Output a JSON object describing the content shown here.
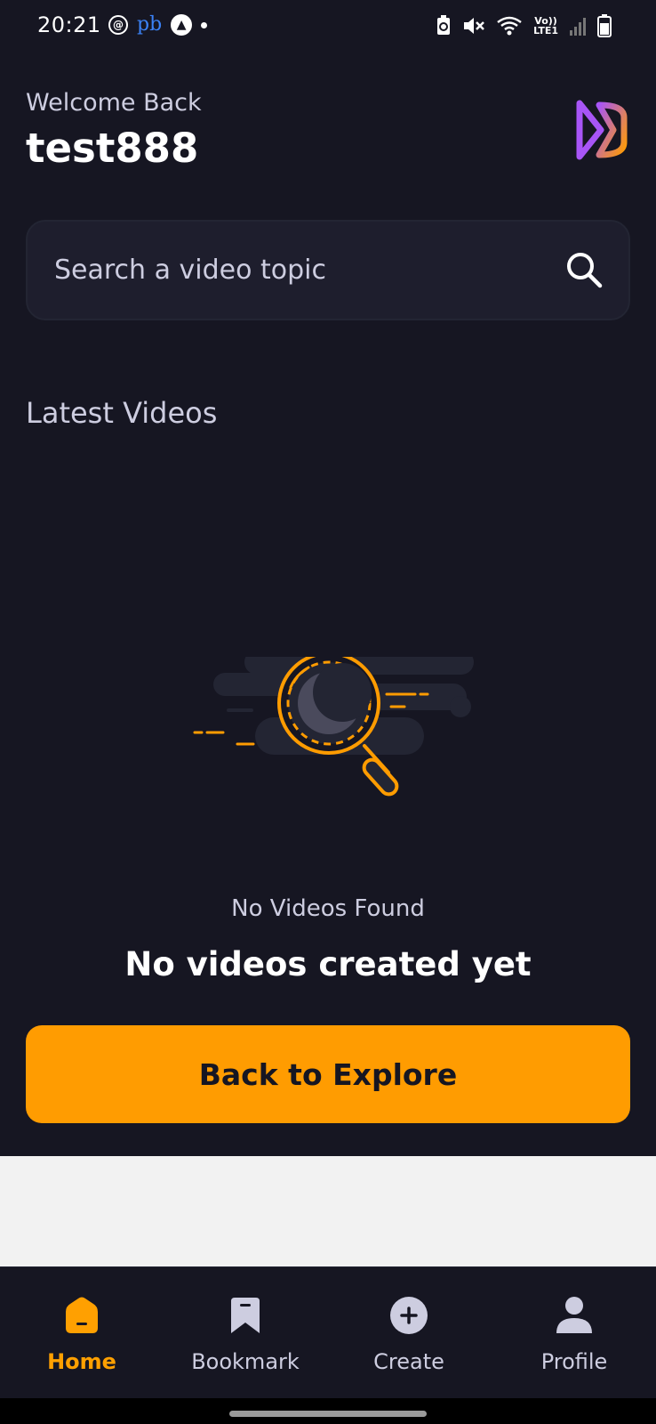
{
  "status_bar": {
    "time": "20:21",
    "app_badge": "pb",
    "network": "Vo))",
    "network_sub": "LTE1",
    "icons": [
      "threads-icon",
      "pb-app-icon",
      "nav-app-icon",
      "notification-dot",
      "battery-saver-icon",
      "mute-icon",
      "wifi-icon",
      "volte-icon",
      "signal-icon",
      "battery-icon"
    ]
  },
  "header": {
    "welcome": "Welcome Back",
    "username": "test888",
    "logo_colors": [
      "#A855F7",
      "#FF9C01"
    ]
  },
  "search": {
    "placeholder": "Search a video topic",
    "value": ""
  },
  "latest": {
    "title": "Latest Videos"
  },
  "empty_state": {
    "title": "No Videos Found",
    "subtitle": "No videos created yet",
    "button_label": "Back to Explore"
  },
  "tabs": [
    {
      "label": "Home",
      "icon": "home-icon",
      "active": true
    },
    {
      "label": "Bookmark",
      "icon": "bookmark-icon",
      "active": false
    },
    {
      "label": "Create",
      "icon": "plus-circle-icon",
      "active": false
    },
    {
      "label": "Profile",
      "icon": "profile-icon",
      "active": false
    }
  ],
  "colors": {
    "background": "#161622",
    "accent": "#FF9C01",
    "active_tab": "#FFA001",
    "inactive_tab": "#CDCDE0",
    "search_bg": "#1E1E2D"
  }
}
